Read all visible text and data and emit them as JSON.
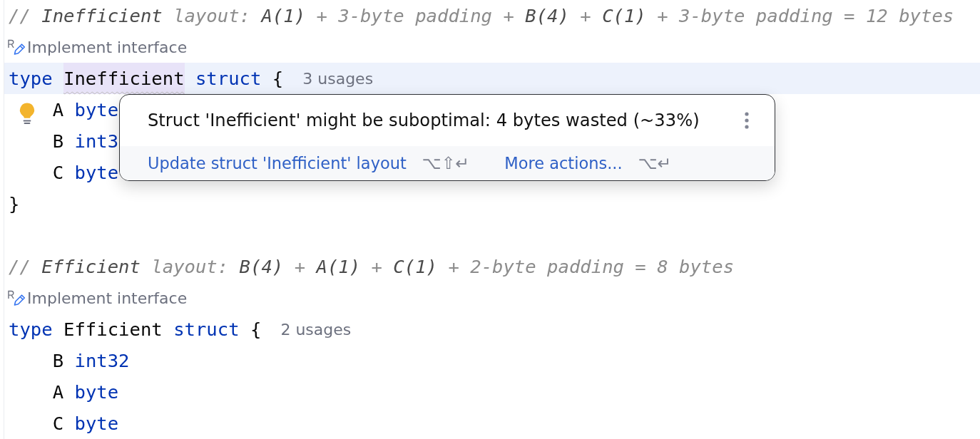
{
  "editor": {
    "lines": [
      {
        "kind": "comment",
        "current": false,
        "bulb": false,
        "tokens": [
          {
            "kind": "comment",
            "text": "// "
          },
          {
            "kind": "comment_ref",
            "text": "Inefficient"
          },
          {
            "kind": "comment",
            "text": " layout: "
          },
          {
            "kind": "comment_ref",
            "text": "A(1)"
          },
          {
            "kind": "comment",
            "text": " + 3-byte padding + "
          },
          {
            "kind": "comment_ref",
            "text": "B(4)"
          },
          {
            "kind": "comment",
            "text": " + "
          },
          {
            "kind": "comment_ref",
            "text": "C(1)"
          },
          {
            "kind": "comment",
            "text": " + 3-byte padding = 12 bytes"
          }
        ]
      },
      {
        "kind": "inlay",
        "current": false,
        "bulb": false,
        "label": "Implement interface"
      },
      {
        "kind": "code",
        "current": true,
        "bulb": false,
        "tokens": [
          {
            "kind": "keyword",
            "text": "type "
          },
          {
            "kind": "flagged",
            "text": "Inefficient"
          },
          {
            "kind": "keyword",
            "text": " struct"
          },
          {
            "kind": "punct",
            "text": " {"
          }
        ],
        "hint": "3 usages",
        "children": [
          {
            "kind": "code",
            "current": false,
            "bulb": true,
            "tokens": [
              {
                "kind": "ident",
                "text": "A"
              },
              {
                "kind": "keyword",
                "text": " byte"
              }
            ]
          },
          {
            "kind": "code",
            "current": false,
            "bulb": false,
            "tokens": [
              {
                "kind": "ident",
                "text": "B"
              },
              {
                "kind": "keyword",
                "text": " int3"
              }
            ]
          },
          {
            "kind": "code",
            "current": false,
            "bulb": false,
            "tokens": [
              {
                "kind": "ident",
                "text": "C"
              },
              {
                "kind": "keyword",
                "text": " byte"
              }
            ]
          }
        ]
      },
      {
        "kind": "code",
        "current": false,
        "bulb": false,
        "tokens": [
          {
            "kind": "punct",
            "text": "}"
          }
        ]
      },
      {
        "kind": "blank",
        "current": false,
        "bulb": false
      },
      {
        "kind": "comment",
        "current": false,
        "bulb": false,
        "tokens": [
          {
            "kind": "comment",
            "text": "// "
          },
          {
            "kind": "comment_ref",
            "text": "Efficient"
          },
          {
            "kind": "comment",
            "text": " layout: "
          },
          {
            "kind": "comment_ref",
            "text": "B(4)"
          },
          {
            "kind": "comment",
            "text": " + "
          },
          {
            "kind": "comment_ref",
            "text": "A(1)"
          },
          {
            "kind": "comment",
            "text": " + "
          },
          {
            "kind": "comment_ref",
            "text": "C(1)"
          },
          {
            "kind": "comment",
            "text": " + 2-byte padding = 8 bytes"
          }
        ]
      },
      {
        "kind": "inlay",
        "current": false,
        "bulb": false,
        "label": "Implement interface"
      },
      {
        "kind": "code",
        "current": false,
        "bulb": false,
        "tokens": [
          {
            "kind": "keyword",
            "text": "type "
          },
          {
            "kind": "ident",
            "text": "Efficient"
          },
          {
            "kind": "keyword",
            "text": " struct"
          },
          {
            "kind": "punct",
            "text": " {"
          }
        ],
        "hint": "2 usages",
        "children": [
          {
            "kind": "code",
            "current": false,
            "bulb": false,
            "tokens": [
              {
                "kind": "ident",
                "text": "B"
              },
              {
                "kind": "keyword",
                "text": " int32"
              }
            ]
          },
          {
            "kind": "code",
            "current": false,
            "bulb": false,
            "tokens": [
              {
                "kind": "ident",
                "text": "A"
              },
              {
                "kind": "keyword",
                "text": " byte"
              }
            ]
          },
          {
            "kind": "code",
            "current": false,
            "bulb": false,
            "tokens": [
              {
                "kind": "ident",
                "text": "C"
              },
              {
                "kind": "keyword",
                "text": " byte"
              }
            ]
          }
        ]
      }
    ]
  },
  "popup": {
    "message": "Struct 'Inefficient' might be suboptimal: 4 bytes wasted (~33%)",
    "actions": [
      {
        "label": "Update struct 'Inefficient' layout",
        "shortcut": "⌥⇧↵"
      },
      {
        "label": "More actions...",
        "shortcut": "⌥↵"
      }
    ]
  }
}
